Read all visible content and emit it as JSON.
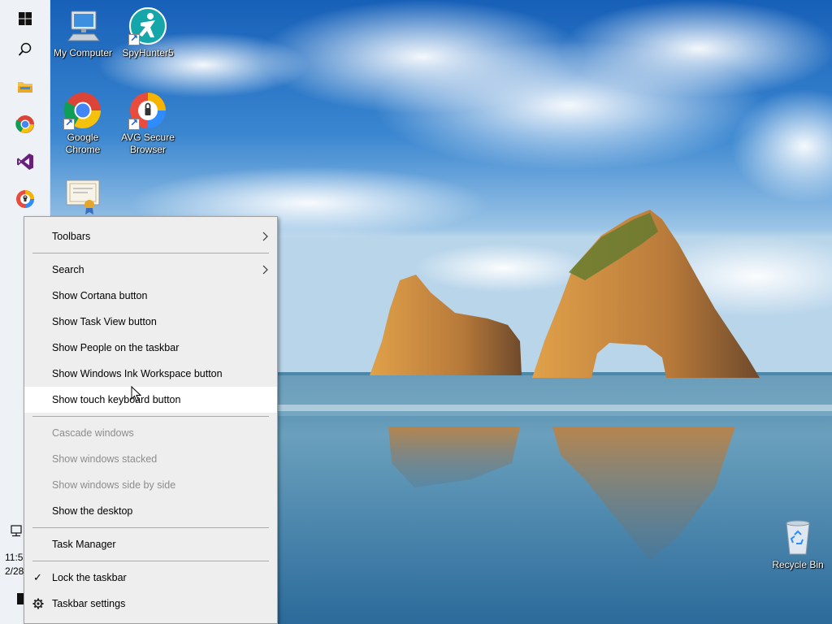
{
  "desktop": {
    "icons": [
      {
        "label": "My Computer",
        "icon": "computer-icon"
      },
      {
        "label": "SpyHunter5",
        "icon": "spyhunter-icon"
      },
      {
        "label": "Google Chrome",
        "icon": "chrome-icon"
      },
      {
        "label": "AVG Secure Browser",
        "icon": "avg-browser-icon"
      },
      {
        "label": "",
        "icon": "certificate-icon"
      },
      {
        "label": "Recycle Bin",
        "icon": "recycle-bin-icon"
      }
    ]
  },
  "taskbar": {
    "buttons": [
      "windows-start-icon",
      "search-icon",
      "file-explorer-icon",
      "chrome-icon",
      "visual-studio-icon",
      "avg-browser-icon"
    ],
    "clock": {
      "time": "11:5",
      "date": "2/28"
    }
  },
  "context_menu": {
    "items": [
      {
        "label": "Toolbars",
        "submenu": true
      },
      {
        "separator": true
      },
      {
        "label": "Search",
        "submenu": true
      },
      {
        "label": "Show Cortana button"
      },
      {
        "label": "Show Task View button"
      },
      {
        "label": "Show People on the taskbar"
      },
      {
        "label": "Show Windows Ink Workspace button"
      },
      {
        "label": "Show touch keyboard button",
        "state": "hover"
      },
      {
        "separator": true
      },
      {
        "label": "Cascade windows",
        "state": "disabled"
      },
      {
        "label": "Show windows stacked",
        "state": "disabled"
      },
      {
        "label": "Show windows side by side",
        "state": "disabled"
      },
      {
        "label": "Show the desktop"
      },
      {
        "separator": true
      },
      {
        "label": "Task Manager"
      },
      {
        "separator": true
      },
      {
        "label": "Lock the taskbar",
        "checked": true
      },
      {
        "label": "Taskbar settings",
        "icon": "gear-icon"
      }
    ]
  },
  "colors": {
    "menu_bg": "#eeeeee",
    "menu_hover": "#ffffff",
    "disabled_text": "#8c8c8c",
    "taskbar_bg": "#eef1f5"
  }
}
